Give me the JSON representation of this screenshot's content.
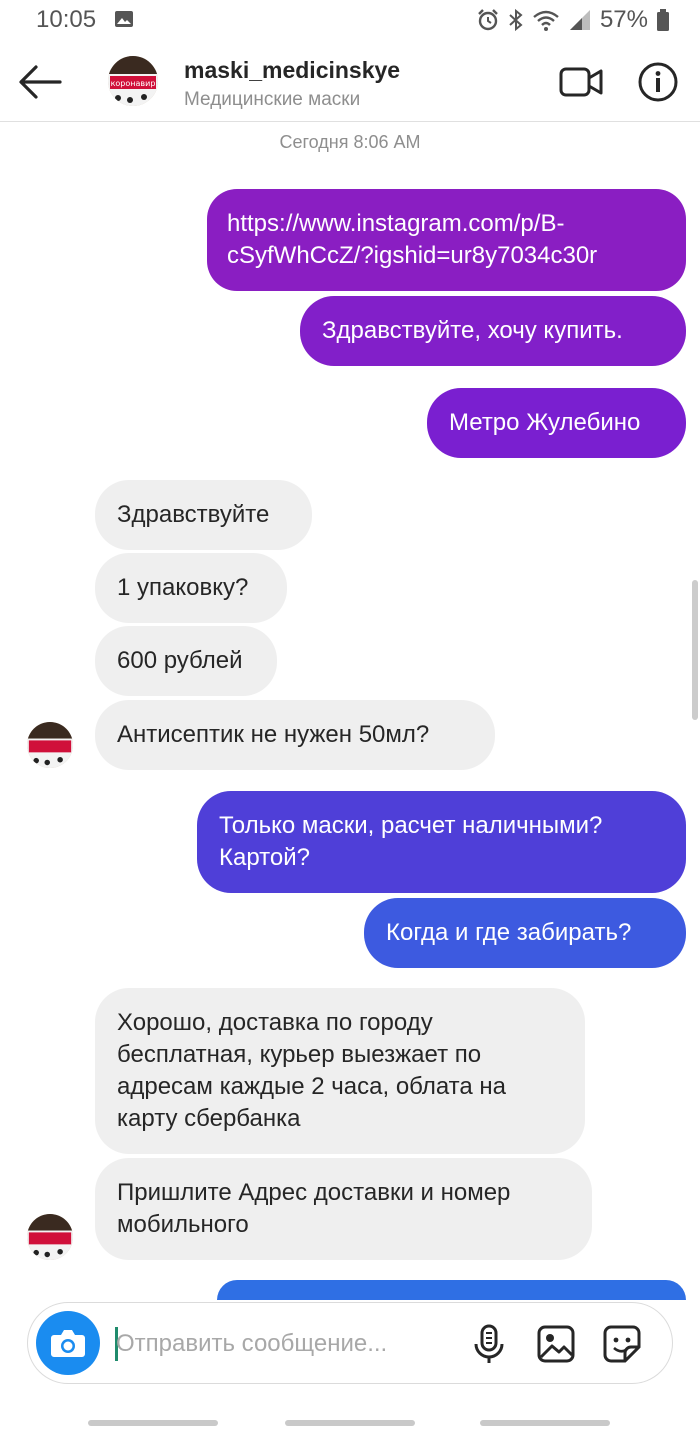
{
  "status_bar": {
    "time": "10:05",
    "battery": "57%"
  },
  "header": {
    "username": "maski_medicinskye",
    "subtitle": "Медицинские маски",
    "avatar_text": "коронавир"
  },
  "thread": {
    "timestamp": "Сегодня 8:06 AM",
    "messages": [
      {
        "from": "me",
        "text": "https://www.instagram.com/p/B-cSyfWhCcZ/?igshid=ur8y7034c30r"
      },
      {
        "from": "me",
        "text": "Здравствуйте, хочу купить."
      },
      {
        "from": "me",
        "text": "Метро Жулебино"
      },
      {
        "from": "them",
        "text": "Здравствуйте"
      },
      {
        "from": "them",
        "text": "1 упаковку?"
      },
      {
        "from": "them",
        "text": "600 рублей"
      },
      {
        "from": "them",
        "text": "Антисептик не нужен 50мл?"
      },
      {
        "from": "me",
        "text": "Только маски, расчет наличными? Картой?"
      },
      {
        "from": "me",
        "text": "Когда и где забирать?"
      },
      {
        "from": "them",
        "text": "Хорошо, доставка по городу бесплатная, курьер выезжает по адресам каждые 2 часа, облата на карту сбербанка"
      },
      {
        "from": "them",
        "text": "Пришлите Адрес доставки и номер мобильного"
      }
    ]
  },
  "composer": {
    "placeholder": "Отправить сообщение..."
  },
  "colors": {
    "bubble_purple": "#8a1ec2",
    "bubble_purple_mid": "#7a1fd0",
    "bubble_indigo": "#4f3fd8",
    "bubble_blue": "#3d5ae0",
    "bubble_incoming": "#efefef",
    "camera_button": "#1a8cf0"
  },
  "icons": [
    "back-arrow-icon",
    "video-call-icon",
    "info-icon",
    "camera-icon",
    "microphone-icon",
    "gallery-icon",
    "sticker-icon"
  ]
}
